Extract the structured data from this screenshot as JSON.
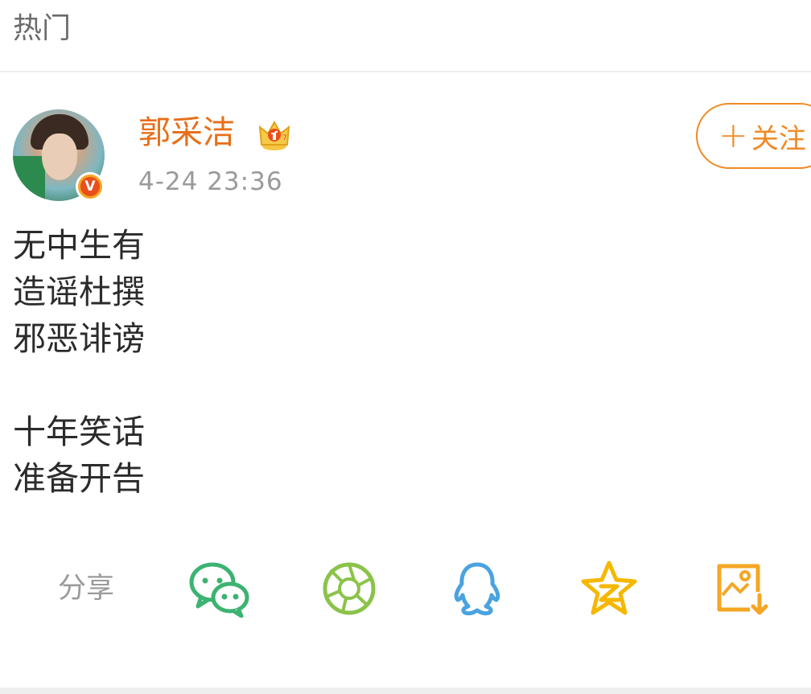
{
  "section": {
    "title": "热门"
  },
  "post": {
    "author": {
      "name": "郭采洁",
      "verified_mark": "V",
      "avatar_icon": "avatar-photo",
      "badge_icon": "crown-icon"
    },
    "timestamp": "4-24 23:36",
    "follow_button": {
      "plus": "+",
      "label": "关注"
    },
    "lines": [
      "无中生有",
      "造谣杜撰",
      "邪恶诽谤",
      "",
      "十年笑话",
      "准备开告"
    ]
  },
  "share": {
    "label": "分享",
    "targets": [
      {
        "name": "wechat",
        "icon": "wechat-icon",
        "color": "#3cb371"
      },
      {
        "name": "moments",
        "icon": "moments-icon",
        "color": "#8bc34a"
      },
      {
        "name": "qq",
        "icon": "qq-icon",
        "color": "#4aa3df"
      },
      {
        "name": "qzone",
        "icon": "qzone-icon",
        "color": "#f5b700"
      },
      {
        "name": "save-image",
        "icon": "save-image-icon",
        "color": "#f5a623"
      }
    ]
  },
  "colors": {
    "accent": "#f08a24",
    "username": "#e86f1a",
    "muted_text": "#9a9a9a"
  }
}
